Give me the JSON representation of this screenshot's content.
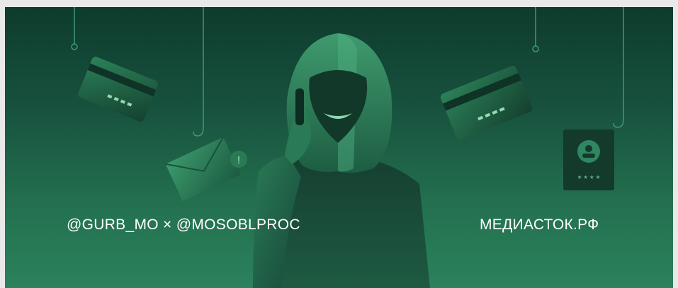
{
  "banner": {
    "left_caption": "@GURB_MO × @MOSOBLPROC",
    "right_caption": "МЕДИАСТОК.РФ",
    "colors": {
      "background_top": "#0e3b2d",
      "background_bottom": "#2b825c",
      "caption_text": "#ffffff"
    }
  }
}
